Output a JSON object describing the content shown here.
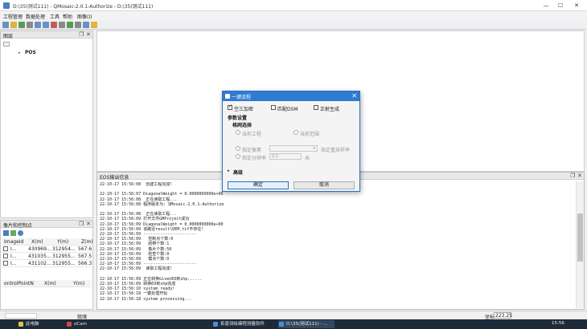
{
  "window": {
    "title": "D:\\35(测试111) - QMosaic-2.0.1-Authorize - D:\\35(测试111)",
    "minimize": "—",
    "maximize": "☐",
    "close": "✕"
  },
  "menu": [
    "工程管理",
    "数据处理",
    "工具",
    "帮助",
    "图像(I)"
  ],
  "layer_panel": {
    "title": "图层",
    "item": "POS"
  },
  "control_panel": {
    "title": "像片和控制点",
    "columns": [
      "ImageId",
      "X(m)",
      "Y(m)",
      "Z(m)"
    ],
    "rows": [
      {
        "id": "I...",
        "x": "430969...",
        "y": "312954...",
        "z": "567.6"
      },
      {
        "id": "I...",
        "x": "431035...",
        "y": "312955...",
        "z": "567.5"
      },
      {
        "id": "I...",
        "x": "431102...",
        "y": "312955...",
        "z": "566.3"
      }
    ],
    "cp_columns": [
      "ontrolPointN",
      "X(m)",
      "Y(m)"
    ]
  },
  "output": {
    "title": "EOS输出信息",
    "lines": [
      "22-10-17 15:56:08  创建工程完成!",
      "",
      "22-10-17 15:56:07 DiagonalWeight = 0.0000000000e+00",
      "22-10-17 15:56:08  正在读取工程...",
      "22-10-17 15:56:08 程序版本为: QMosaic-2.0.1-Authorize",
      "",
      "22-10-17 15:56:08  正在读取工程...",
      "22-10-17 15:56:09 打开文件GMProject成功",
      "22-10-17 15:56:09 DiagonalWeight = 0.0000000000e+00",
      "22-10-17 15:56:09 该路径result\\DEM.tif不存在!",
      "22-10-17 15:56:09 ----------------------",
      "22-10-17 15:56:09   控制点个数:0",
      "22-10-17 15:56:09   航带个数:1",
      "22-10-17 15:56:09   像片个数:50",
      "22-10-17 15:56:09   检查个数:0",
      "22-10-17 15:56:09   模点个数:0",
      "22-10-17 15:56:09 ----------------------",
      "22-10-17 15:56:09  读取工程完成!",
      "",
      "22-10-17 15:56:09 正在转换GivenEO到shp......",
      "22-10-17 15:56:09 转换EO到shp完成",
      "22-10-17 15:56:10 system ready!",
      "22-10-17 15:56:18 一键处理开始",
      "22-10-17 15:56:18 system processing..."
    ]
  },
  "dialog": {
    "title": "一键流程",
    "opt1": "空三加密",
    "opt2": "匹配DSM",
    "opt3": "正射生成",
    "section": "参数设置",
    "range": "格网选择",
    "radio1": "当前工程",
    "radio2": "当前范围",
    "opt_a": "指定像素",
    "opt_b": "指定分辨率",
    "val_b": "0.2",
    "note": "指定重采样率",
    "note2": "米",
    "advanced": "高级",
    "ok": "确定",
    "cancel": "取消"
  },
  "status": {
    "coord_label": "坐标",
    "zoom": "223.25",
    "label_left": "就绪"
  },
  "taskbar": {
    "items": [
      "此电脑",
      "oCam",
      "拓普测绘编程测量软件",
      "D:\\35(测试111) - ...",
      ""
    ],
    "time": "15:56"
  }
}
